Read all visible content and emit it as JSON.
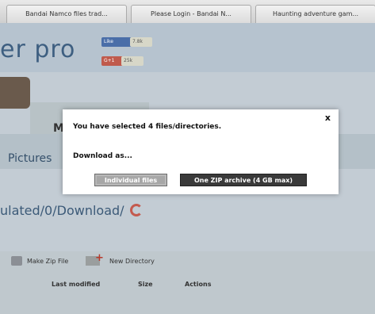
{
  "browser": {
    "tabs": [
      {
        "label": "Bandai Namco files trad..."
      },
      {
        "label": "Please Login - Bandai N..."
      },
      {
        "label": "Haunting adventure gam..."
      }
    ]
  },
  "page": {
    "logo_text": "er pro",
    "social": {
      "fb_like": "Like",
      "fb_count": "7.8k",
      "gplus": "G+1",
      "gplus_count": "25k"
    },
    "banner_letter": "M",
    "nav_pictures": "Pictures",
    "path": "ulated/0/Download/",
    "toolbar": {
      "make_zip": "Make Zip File",
      "new_directory": "New Directory"
    },
    "table_headers": {
      "last_modified": "Last modified",
      "size": "Size",
      "actions": "Actions"
    }
  },
  "modal": {
    "close": "x",
    "message": "You have selected 4 files/directories.",
    "download_as": "Download as...",
    "individual_button": "Individual files",
    "zip_button": "One ZIP archive (4 GB max)"
  }
}
